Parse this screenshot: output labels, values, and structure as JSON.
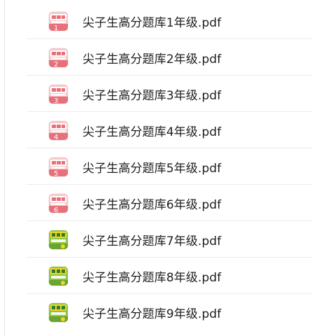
{
  "files": [
    {
      "name": "尖子生高分题库1年级.pdf",
      "grade": "1",
      "cover": "pink",
      "icon": "pdf-cover-thumbnail-icon"
    },
    {
      "name": "尖子生高分题库2年级.pdf",
      "grade": "2",
      "cover": "pink",
      "icon": "pdf-cover-thumbnail-icon"
    },
    {
      "name": "尖子生高分题库3年级.pdf",
      "grade": "3",
      "cover": "pink",
      "icon": "pdf-cover-thumbnail-icon"
    },
    {
      "name": "尖子生高分题库4年级.pdf",
      "grade": "4",
      "cover": "pink",
      "icon": "pdf-cover-thumbnail-icon"
    },
    {
      "name": "尖子生高分题库5年级.pdf",
      "grade": "5",
      "cover": "pink",
      "icon": "pdf-cover-thumbnail-icon"
    },
    {
      "name": "尖子生高分题库6年级.pdf",
      "grade": "6",
      "cover": "pink",
      "icon": "pdf-cover-thumbnail-icon"
    },
    {
      "name": "尖子生高分题库7年级.pdf",
      "grade": "7",
      "cover": "green",
      "icon": "pdf-cover-thumbnail-icon"
    },
    {
      "name": "尖子生高分题库8年级.pdf",
      "grade": "8",
      "cover": "green",
      "icon": "pdf-cover-thumbnail-icon"
    },
    {
      "name": "尖子生高分题库9年级.pdf",
      "grade": "9",
      "cover": "green",
      "icon": "pdf-cover-thumbnail-icon"
    }
  ],
  "colors": {
    "pink_cover": "#e8707a",
    "pink_light": "#f6c7cb",
    "green_cover": "#8cc63f",
    "green_dark": "#2e7d32",
    "yellow_title": "#f5d327",
    "text": "#1e1e1e",
    "divider": "#ececec"
  }
}
